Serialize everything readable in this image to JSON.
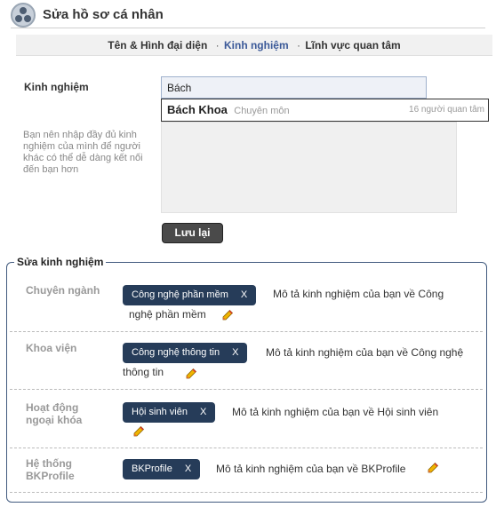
{
  "header": {
    "title": "Sửa hồ sơ cá nhân"
  },
  "tabs": [
    {
      "label": "Tên & Hình đại diện",
      "active": false
    },
    {
      "label": "Kinh nghiệm",
      "active": true
    },
    {
      "label": "Lĩnh vực quan tâm",
      "active": false
    }
  ],
  "tab_separator": "·",
  "form": {
    "label": "Kinh nghiệm",
    "input_value": "Bách",
    "hint": "Bạn nên nhập đầy đủ kinh nghiệm của mình để người khác có thể dễ dàng kết nối đến bạn hơn",
    "save_label": "Lưu lại"
  },
  "suggestion": {
    "name": "Bách Khoa",
    "category": "Chuyên môn",
    "count": "16 người quan tâm"
  },
  "edit_section": {
    "legend": "Sửa kinh nghiệm",
    "rows": [
      {
        "label": "Chuyên ngành",
        "tag": "Công nghệ phần mềm",
        "remove": "X",
        "desc": "Mô tả kinh nghiệm của bạn về Công nghệ phần mềm",
        "desc_line1": "Mô tả kinh nghiệm của bạn về Công",
        "desc_line2": "nghệ phần mềm"
      },
      {
        "label": "Khoa viện",
        "tag": "Công nghệ thông tin",
        "remove": "X",
        "desc": "Mô tả kinh nghiệm của bạn về Công nghệ thông tin",
        "desc_line1": "Mô tả kinh nghiệm của bạn về Công nghệ",
        "desc_line2": "thông tin"
      },
      {
        "label": "Hoạt động ngoại khóa",
        "label_line1": "Hoạt động",
        "label_line2": "ngoại khóa",
        "tag": "Hội sinh viên",
        "remove": "X",
        "desc": "Mô tả kinh nghiệm của bạn về Hội sinh viên"
      },
      {
        "label": "Hệ thống BKProfile",
        "label_line1": "Hệ thống",
        "label_line2": "BKProfile",
        "tag": "BKProfile",
        "remove": "X",
        "desc": "Mô tả kinh nghiệm của bạn về BKProfile"
      }
    ]
  },
  "colors": {
    "accent": "#3b5998",
    "chip": "#263c59",
    "border": "#415a7e"
  },
  "icons": {
    "logo": "network-logo-icon",
    "edit": "pencil-icon"
  }
}
